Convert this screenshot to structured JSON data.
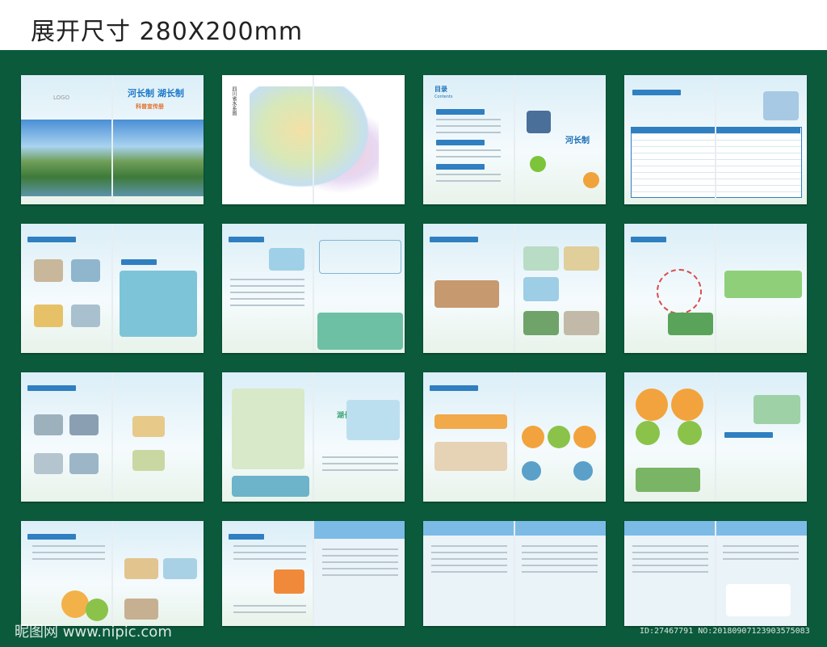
{
  "header": {
    "title": "展开尺寸  280X200mm"
  },
  "spreads": {
    "cover": {
      "logo": "LOGO",
      "title": "河长制  湖长制",
      "subtitle": "科普宣传册"
    },
    "map": {
      "label": "四川省水系图"
    },
    "toc": {
      "title": "目录",
      "subtitle": "Contents",
      "brand": "河长制"
    },
    "heading_hu": "湖长制"
  },
  "watermark": {
    "site": "昵图网 www.nipic.com",
    "id": "ID:27467791 NO:20180907123903575083"
  }
}
